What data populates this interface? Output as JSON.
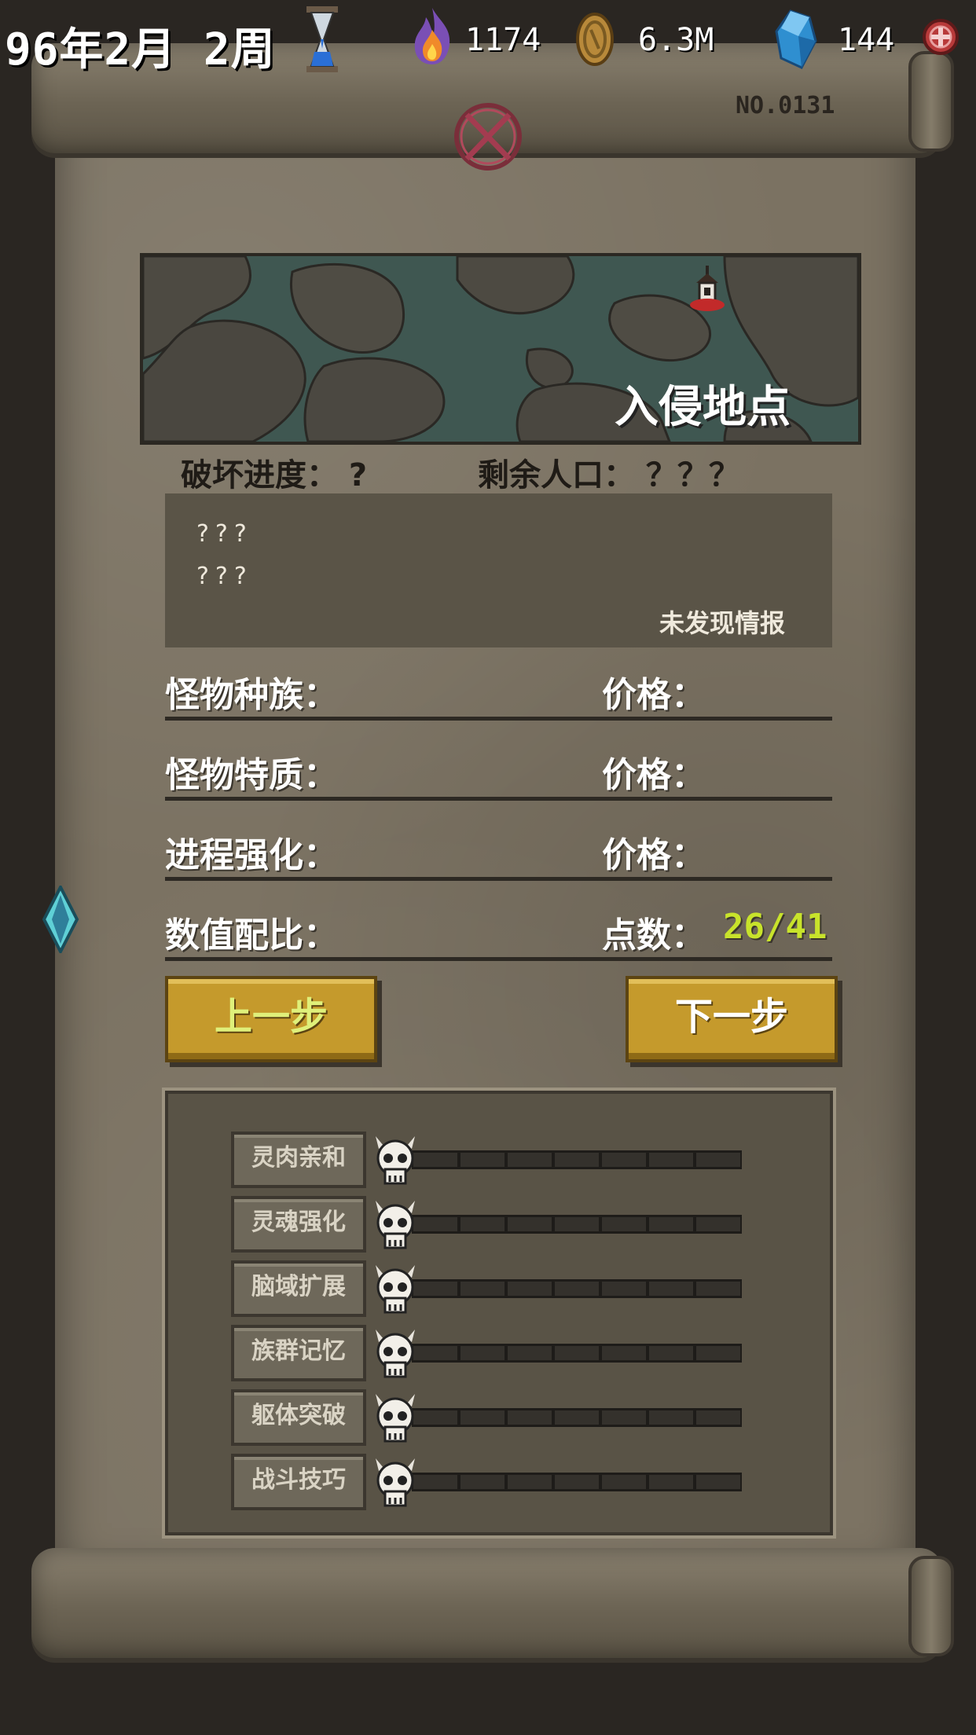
{
  "topbar": {
    "date": "96年2月 2周",
    "flame_value": "1174",
    "coin_value": "6.3M",
    "crystal_value": "144",
    "icons": [
      "hourglass-icon",
      "flame-icon",
      "coin-icon",
      "crystal-icon",
      "add-icon"
    ]
  },
  "scroll": {
    "doc_no": "NO.0131",
    "map_title": "入侵地点",
    "destruction_label": "破坏进度： ?",
    "population_label": "剩余人口： ？？？",
    "intel_line1": "???",
    "intel_line2": "???",
    "intel_footer": "未发现情报",
    "rows": [
      {
        "label": "怪物种族：",
        "right_label": "价格："
      },
      {
        "label": "怪物特质：",
        "right_label": "价格："
      },
      {
        "label": "进程强化：",
        "right_label": "价格："
      }
    ],
    "ratio_label": "数值配比：",
    "points_label": "点数：",
    "points_value": "26/41",
    "prev_button": "上一步",
    "next_button": "下一步",
    "stats": [
      {
        "name": "灵肉亲和",
        "level": 0,
        "max": 7
      },
      {
        "name": "灵魂强化",
        "level": 0,
        "max": 7
      },
      {
        "name": "脑域扩展",
        "level": 0,
        "max": 7
      },
      {
        "name": "族群记忆",
        "level": 0,
        "max": 7
      },
      {
        "name": "躯体突破",
        "level": 0,
        "max": 7
      },
      {
        "name": "战斗技巧",
        "level": 0,
        "max": 7
      }
    ]
  },
  "colors": {
    "points": "#c8e32b",
    "button": "#c59a2c",
    "parchment": "#7b7262"
  }
}
